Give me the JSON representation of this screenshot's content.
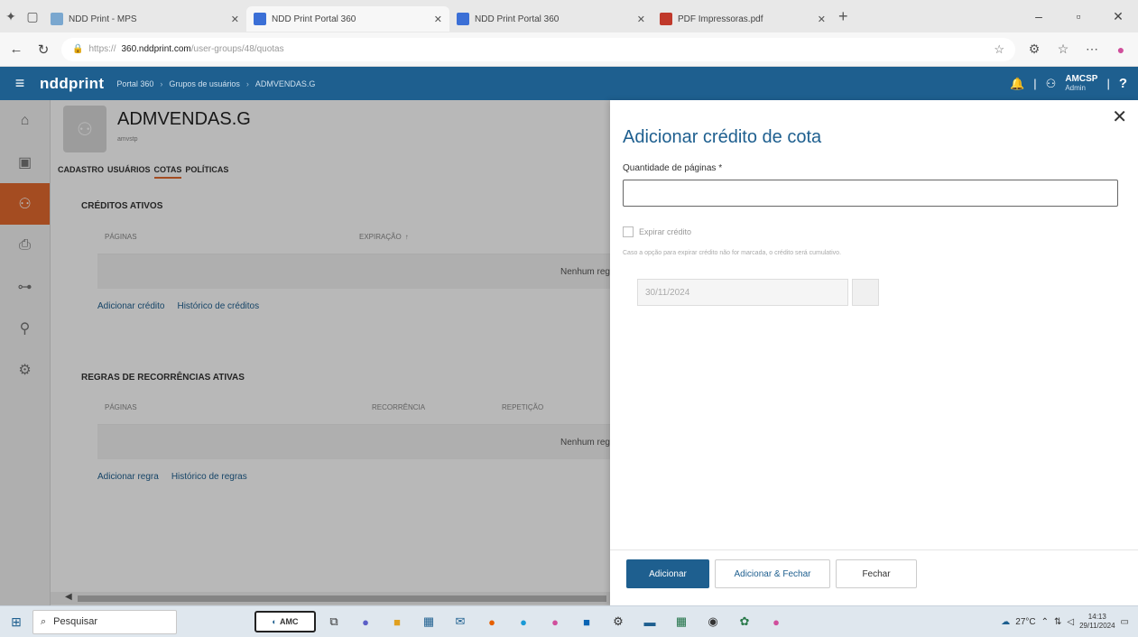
{
  "browser": {
    "tabs": [
      {
        "title": "NDD Print - MPS",
        "favicon_color": "#7aa7cf",
        "active": false
      },
      {
        "title": "NDD Print Portal 360",
        "favicon_color": "#3b6fd6",
        "active": true
      },
      {
        "title": "NDD Print Portal 360",
        "favicon_color": "#3b6fd6",
        "active": false
      },
      {
        "title": "PDF Impressoras.pdf",
        "favicon_color": "#c0392b",
        "active": false
      }
    ],
    "url_prefix": "https://",
    "url_host": "360.nddprint.com",
    "url_path": "/user-groups/48/quotas"
  },
  "header": {
    "logo": "nddprint",
    "breadcrumbs": [
      "Portal 360",
      "Grupos de usuários",
      "ADMVENDAS.G"
    ],
    "user_name": "AMCSP",
    "user_role": "Admin",
    "help": "?"
  },
  "leftnav": {
    "items": [
      {
        "icon": "home-icon",
        "glyph": "⌂"
      },
      {
        "icon": "devices-icon",
        "glyph": "▣"
      },
      {
        "icon": "users-icon",
        "glyph": "⚇"
      },
      {
        "icon": "printer-icon",
        "glyph": "⎙"
      },
      {
        "icon": "hierarchy-icon",
        "glyph": "⊶"
      },
      {
        "icon": "user-settings-icon",
        "glyph": "⚲"
      },
      {
        "icon": "settings-icon",
        "glyph": "⚙"
      }
    ]
  },
  "group": {
    "title": "ADMVENDAS.G",
    "subtitle": "amvstp",
    "tabs": [
      "CADASTRO",
      "USUÁRIOS",
      "COTAS",
      "POLÍTICAS"
    ],
    "credits_title": "CRÉDITOS ATIVOS",
    "credits_cols": [
      "PÁGINAS",
      "EXPIRAÇÃO"
    ],
    "empty_text": "Nenhum reg",
    "credit_links": [
      "Adicionar crédito",
      "Histórico de créditos"
    ],
    "rules_title": "REGRAS DE RECORRÊNCIAS ATIVAS",
    "rules_cols": [
      "PÁGINAS",
      "RECORRÊNCIA",
      "REPETIÇÃO"
    ],
    "rule_links": [
      "Adicionar regra",
      "Histórico de regras"
    ]
  },
  "panel": {
    "title": "Adicionar crédito de cota",
    "pages_label": "Quantidade de páginas *",
    "pages_value": "",
    "expire_label": "Expirar crédito",
    "help_text": "Caso a opção para expirar crédito não for marcada, o crédito será cumulativo.",
    "date_value": "30/11/2024",
    "btn_add": "Adicionar",
    "btn_add_close": "Adicionar & Fechar",
    "btn_close": "Fechar"
  },
  "taskbar": {
    "search_placeholder": "Pesquisar",
    "amc_label": "AMC",
    "weather": "27°C",
    "time": "14:13",
    "date": "29/11/2024"
  }
}
